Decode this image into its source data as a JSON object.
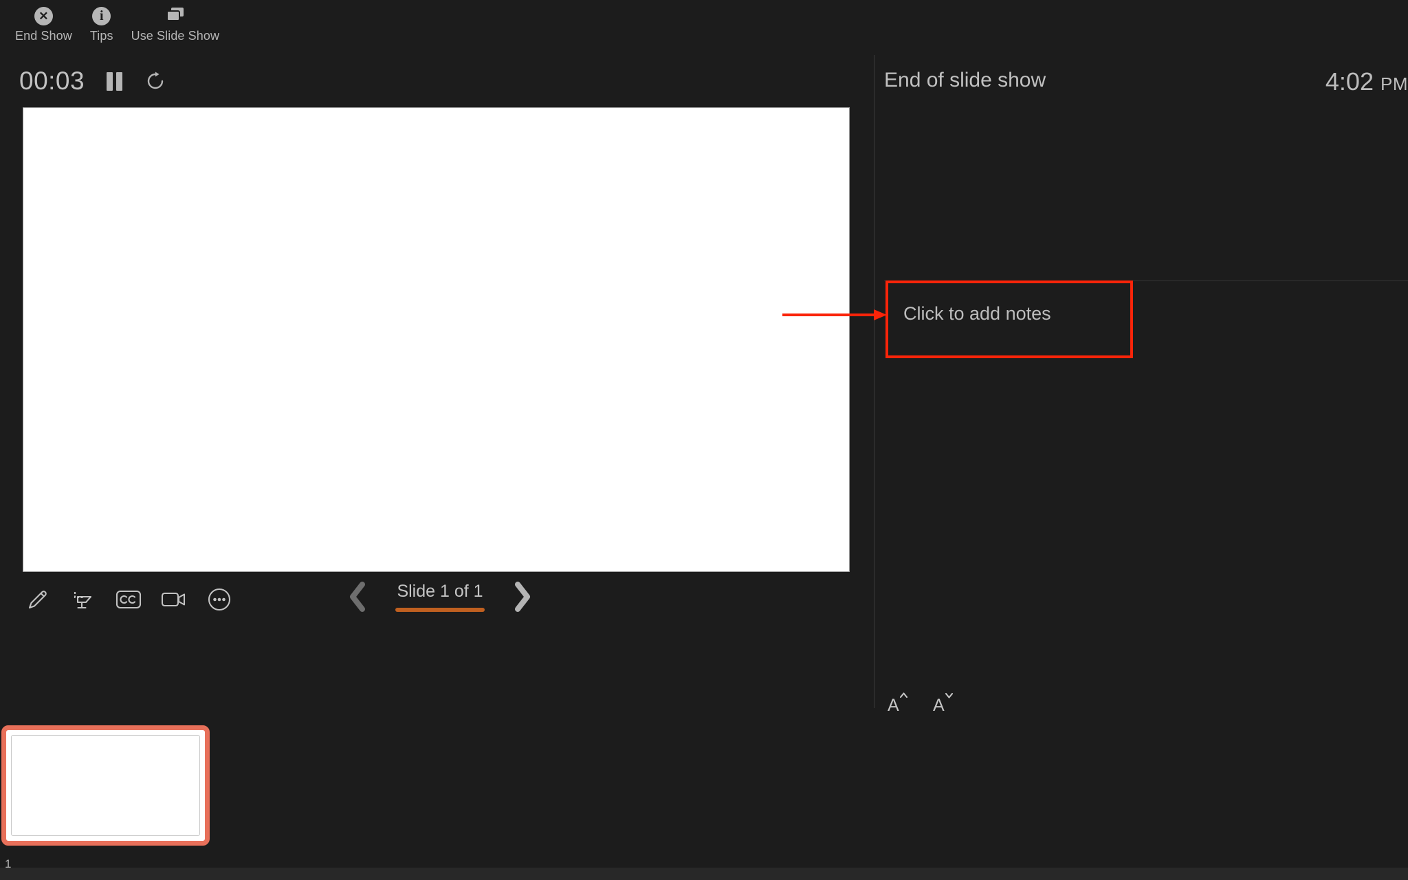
{
  "toolbar": {
    "items": [
      {
        "icon": "close-circle-icon",
        "label": "End Show"
      },
      {
        "icon": "info-circle-icon",
        "label": "Tips"
      },
      {
        "icon": "slide-stack-icon",
        "label": "Use Slide Show"
      }
    ]
  },
  "timer": {
    "elapsed": "00:03",
    "pause_icon": "pause-icon",
    "restart_icon": "restart-icon"
  },
  "clock": {
    "time": "4:02",
    "period": "PM"
  },
  "presenter_tools": [
    {
      "icon": "pen-icon",
      "name": "pen-tool"
    },
    {
      "icon": "laser-pointer-icon",
      "name": "pointer-tool"
    },
    {
      "icon": "closed-captions-icon",
      "name": "captions-tool"
    },
    {
      "icon": "camera-icon",
      "name": "camera-tool"
    },
    {
      "icon": "more-ellipsis-icon",
      "name": "more-tool"
    }
  ],
  "navigation": {
    "previous_icon": "chevron-left-icon",
    "next_icon": "chevron-right-icon",
    "label": "Slide 1 of 1",
    "progress_percent": 100,
    "progress_color": "#c06020"
  },
  "notes_panel": {
    "title": "End of slide show",
    "placeholder": "Click to add notes",
    "increase_font_label": "A",
    "decrease_font_label": "A"
  },
  "annotation": {
    "color": "#fa2409",
    "target": "Click to add notes"
  },
  "thumbnails": {
    "selection_color": "#e8705a",
    "items": [
      {
        "number": "1",
        "selected": true
      }
    ]
  }
}
